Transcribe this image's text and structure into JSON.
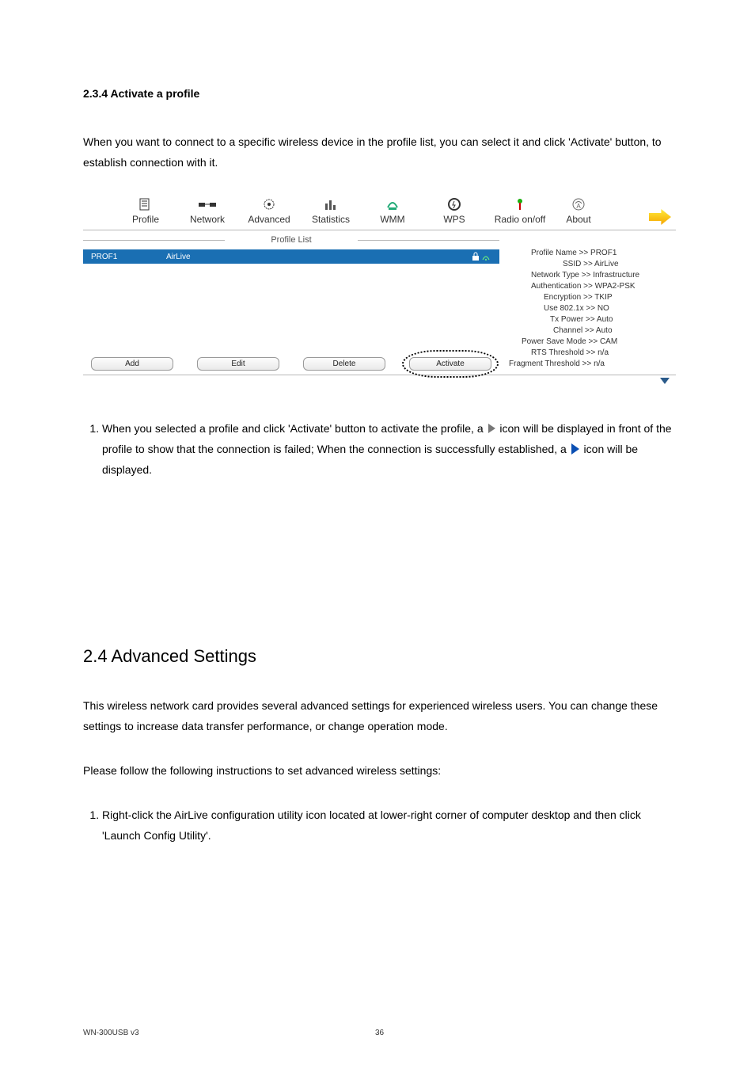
{
  "headings": {
    "h234": "2.3.4 Activate a profile",
    "h24": "2.4 Advanced Settings"
  },
  "paragraphs": {
    "p1": "When you want to connect to a specific wireless device in the profile list, you can select it and click 'Activate' button, to establish connection with it.",
    "p24a": "This wireless network card provides several advanced settings for experienced wireless users. You can change these settings to increase data transfer performance, or change operation mode.",
    "p24b": "Please follow the following instructions to set advanced wireless settings:"
  },
  "list1": {
    "item1_a": "When you selected a profile and click 'Activate' button to activate the profile, a ",
    "item1_b": " icon will be displayed in front of the profile to show that the connection is failed; When the connection is successfully established, a ",
    "item1_c": " icon will be displayed."
  },
  "list2": {
    "item1": "Right-click the AirLive configuration utility icon located at lower-right corner of computer desktop and then click 'Launch Config Utility'."
  },
  "screenshot": {
    "tabs": {
      "profile": "Profile",
      "network": "Network",
      "advanced": "Advanced",
      "statistics": "Statistics",
      "wmm": "WMM",
      "wps": "WPS",
      "radio": "Radio on/off",
      "about": "About"
    },
    "profile_list_label": "Profile List",
    "row": {
      "name": "PROF1",
      "ssid": "AirLive"
    },
    "buttons": {
      "add": "Add",
      "edit": "Edit",
      "del": "Delete",
      "activate": "Activate"
    },
    "details": {
      "l1": "Profile Name >> PROF1",
      "l2": "SSID >> AirLive",
      "l3": "Network Type >> Infrastructure",
      "l4": "Authentication >> WPA2-PSK",
      "l5": "Encryption >> TKIP",
      "l6": "Use 802.1x >> NO",
      "l7": "Tx Power >> Auto",
      "l8": "Channel >> Auto",
      "l9": "Power Save Mode >> CAM",
      "l10": "RTS Threshold >> n/a",
      "l11": "Fragment Threshold >> n/a"
    }
  },
  "footer": {
    "model": "WN-300USB v3",
    "page": "36"
  }
}
